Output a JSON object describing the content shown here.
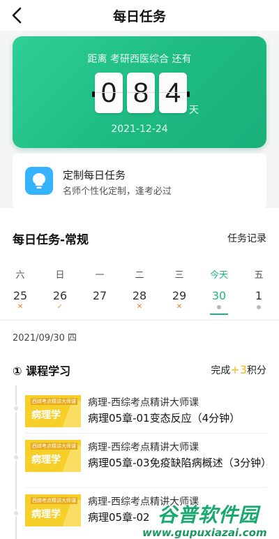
{
  "header": {
    "title": "每日任务"
  },
  "countdown": {
    "label": "距离 考研西医综合 还有",
    "digits": [
      "0",
      "8",
      "4"
    ],
    "unit": "天",
    "date": "2021-12-24"
  },
  "custom_task": {
    "title": "定制每日任务",
    "subtitle": "名师个性化定制，逢考必过"
  },
  "section": {
    "title": "每日任务-常规",
    "record_label": "任务记录"
  },
  "week": [
    {
      "weekday": "六",
      "date": "25",
      "mark": "✕"
    },
    {
      "weekday": "日",
      "date": "26",
      "mark": "✓"
    },
    {
      "weekday": "一",
      "date": "27",
      "mark": ""
    },
    {
      "weekday": "二",
      "date": "28",
      "mark": "✕"
    },
    {
      "weekday": "三",
      "date": "29",
      "mark": "✕"
    },
    {
      "weekday": "今天",
      "date": "30",
      "mark": ""
    },
    {
      "weekday": "五",
      "date": "1",
      "mark": ""
    }
  ],
  "selected_date": "2021/09/30 四",
  "course": {
    "heading": "① 课程学习",
    "points_prefix": "完成",
    "points_value": "+3",
    "points_suffix": "积分"
  },
  "lessons": [
    {
      "thumb_top": "西综考点精讲大师课",
      "thumb_label": "病理学",
      "course": "病理-西综考点精讲大师课",
      "title": "病理05章-01变态反应（4分钟）"
    },
    {
      "thumb_top": "西综考点精讲大师课",
      "thumb_label": "病理学",
      "course": "病理-西综考点精讲大师课",
      "title": "病理05章-03免疫缺陷病概述（3分钟）"
    },
    {
      "thumb_top": "西综考点精讲大师课",
      "thumb_label": "病理学",
      "course": "病理-西综考点精讲大师课",
      "title": "病理05章-02"
    }
  ],
  "watermark": {
    "main": "谷普软件园",
    "url": "www.gupuxiazai.com"
  },
  "colors": {
    "accent": "#1db680",
    "card_gradient_start": "#2fcf95",
    "mark_x": "#f07b1c",
    "points": "#f3b81a"
  }
}
